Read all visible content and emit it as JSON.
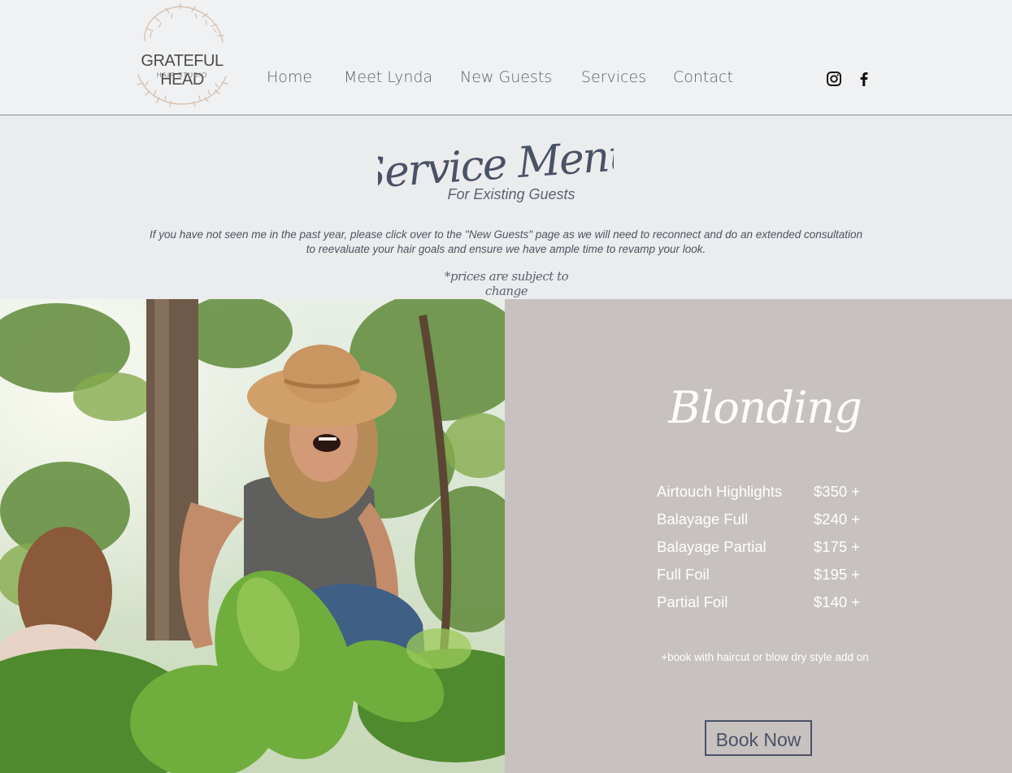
{
  "logo": {
    "name": "GRATEFUL HEAD",
    "sub": "HAIR STUDIO"
  },
  "nav": {
    "items": [
      "Home",
      "Meet Lynda",
      "New Guests",
      "Services",
      "Contact"
    ]
  },
  "social": {
    "icons": [
      "instagram-icon",
      "facebook-icon"
    ]
  },
  "hero": {
    "title": "Service Menu",
    "subtitle": "For Existing Guests",
    "note_line1": "If you have not seen me in the past year, please click over to the \"New Guests\" page as we will need to reconnect and do an extended consultation",
    "note_line2": "to reevaluate your hair goals and ensure we have ample time to revamp your look.",
    "prices_note": "*prices are subject to change"
  },
  "section": {
    "title": "Blonding",
    "services": [
      {
        "name": "Airtouch Highlights",
        "price": "$350 +"
      },
      {
        "name": "Balayage  Full",
        "price": "$240 +"
      },
      {
        "name": "Balayage Partial",
        "price": "$175 +"
      },
      {
        "name": "Full Foil",
        "price": "$195 +"
      },
      {
        "name": "Partial Foil",
        "price": "$140 +"
      }
    ],
    "addon": "+book with haircut or blow dry style add on",
    "book_label": "Book Now"
  },
  "colors": {
    "accent": "#4a5266",
    "panel": "#c7c2bf",
    "header": "#f0f1f2",
    "page": "#ebecee"
  }
}
